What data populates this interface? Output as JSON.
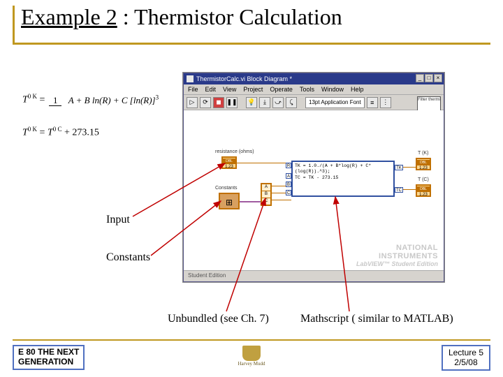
{
  "title_part1": "Example 2",
  "title_sep": " : ",
  "title_part2": "Thermistor Calculation",
  "formula1": {
    "lhs": "T",
    "lhs_sup": "0 K",
    "eq": " = ",
    "num": "1",
    "den": "A + B ln(R) + C [ln(R)]",
    "den_sup": "3"
  },
  "formula2": {
    "lhs": "T",
    "lhs_sup": "0 K",
    "eq": " = ",
    "rhs1": "T",
    "rhs1_sup": "0 C",
    "rhs2": " + 273.15"
  },
  "lv": {
    "window_title": "ThermistorCalc.vi Block Diagram *",
    "menu": [
      "File",
      "Edit",
      "View",
      "Project",
      "Operate",
      "Tools",
      "Window",
      "Help"
    ],
    "toolbar_run": "▷",
    "toolbar_loop": "⟳",
    "toolbar_stop": "◼",
    "toolbar_pause": "❚❚",
    "toolbar_bulb": "💡",
    "toolbar_step": "⤓",
    "font_label": "13pt Application Font",
    "vi_icon_text": "Filter\nthermi",
    "labels": {
      "resistance": "resistance (ohms)",
      "constants": "Constants",
      "tk": "T (K)",
      "tc": "T (C)"
    },
    "node_text": {
      "resistance": "1.23",
      "constants_cluster": "⊞",
      "tk": "1.23",
      "tc": "1.23"
    },
    "unbundle": [
      "A",
      "B",
      "C"
    ],
    "mathscript_line1": "TK = 1.0./(A + B*log(R) + C*(log(R)).^3);",
    "mathscript_line2": "TC = TK - 273.15",
    "ms_in": [
      "R",
      "A",
      "B",
      "C"
    ],
    "ms_out": [
      "TK",
      "TC"
    ],
    "ni_brand1": "NATIONAL",
    "ni_brand2": "INSTRUMENTS",
    "ni_brand3": "LabVIEW™ Student Edition",
    "status_left": "Student Edition",
    "status_right": ""
  },
  "callouts": {
    "input": "Input",
    "constants": "Constants",
    "unbundled": "Unbundled (see Ch. 7)",
    "mathscript": "Mathscript ( similar to MATLAB)"
  },
  "footer": {
    "left_line1": "E 80 THE NEXT",
    "left_line2": "GENERATION",
    "right_line1": "Lecture 5",
    "right_line2": "2/5/08",
    "logo_text": "Harvey Mudd"
  }
}
